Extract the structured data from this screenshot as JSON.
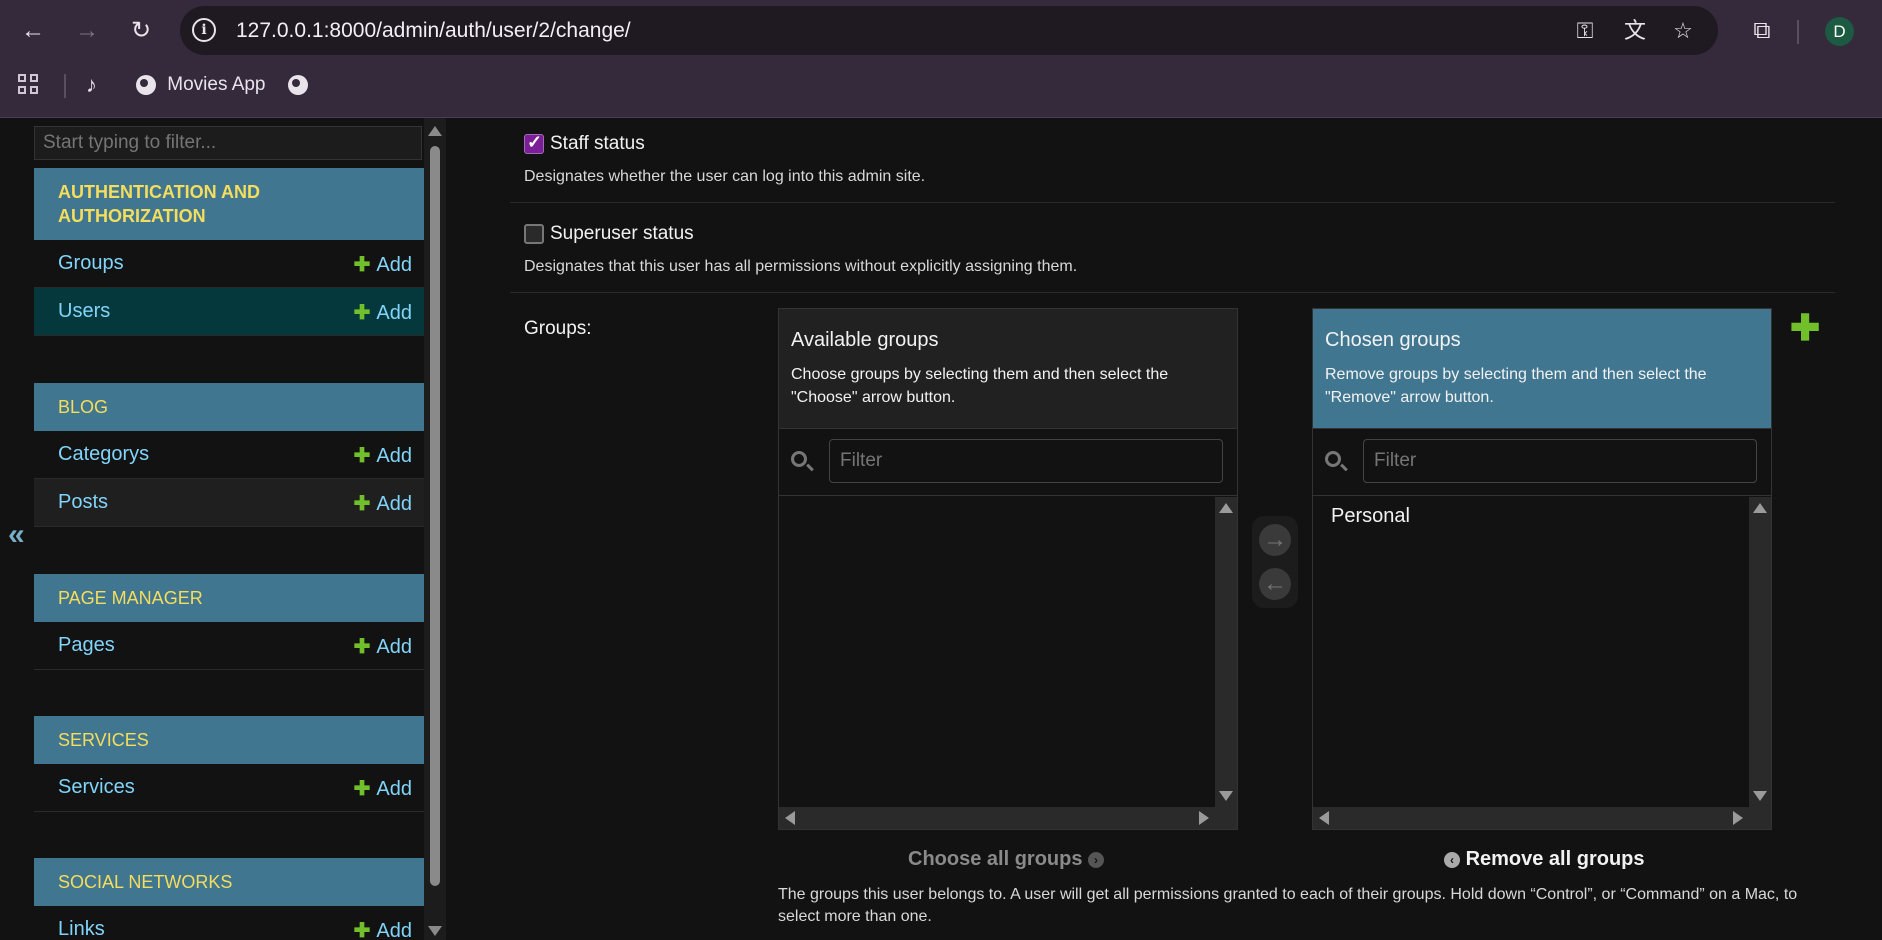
{
  "browser": {
    "url": "127.0.0.1:8000/admin/auth/user/2/change/",
    "avatar_letter": "D",
    "bookmarks": [
      {
        "label": "Movies App"
      }
    ]
  },
  "sidebar": {
    "filter_placeholder": "Start typing to filter...",
    "collapse_label": "«",
    "add_label": "Add",
    "modules": [
      {
        "title": "AUTHENTICATION AND AUTHORIZATION",
        "items": [
          {
            "label": "Groups"
          },
          {
            "label": "Users",
            "selected": true
          }
        ]
      },
      {
        "title": "BLOG",
        "items": [
          {
            "label": "Categorys"
          },
          {
            "label": "Posts"
          }
        ]
      },
      {
        "title": "PAGE MANAGER",
        "items": [
          {
            "label": "Pages"
          }
        ]
      },
      {
        "title": "SERVICES",
        "items": [
          {
            "label": "Services"
          }
        ]
      },
      {
        "title": "SOCIAL NETWORKS",
        "items": [
          {
            "label": "Links"
          }
        ]
      }
    ]
  },
  "form": {
    "staff": {
      "label": "Staff status",
      "checked": true,
      "help": "Designates whether the user can log into this admin site."
    },
    "superuser": {
      "label": "Superuser status",
      "checked": false,
      "help": "Designates that this user has all permissions without explicitly assigning them."
    },
    "groups": {
      "label": "Groups:",
      "available": {
        "title": "Available groups",
        "description": "Choose groups by selecting them and then select the \"Choose\" arrow button.",
        "filter_placeholder": "Filter",
        "options": []
      },
      "chosen": {
        "title": "Chosen groups",
        "description": "Remove groups by selecting them and then select the \"Remove\" arrow button.",
        "filter_placeholder": "Filter",
        "options": [
          "Personal"
        ]
      },
      "choose_all": "Choose all groups",
      "remove_all": "Remove all groups",
      "help": "The groups this user belongs to. A user will get all permissions granted to each of their groups. Hold down “Control”, or “Command” on a Mac, to select more than one."
    }
  },
  "colors": {
    "module_header": "#417690",
    "link": "#81d4fa",
    "add_green": "#70bf2b",
    "header_text": "#f5dd5d",
    "checkbox_on": "#7a1f95",
    "selected_row": "#05383d"
  }
}
